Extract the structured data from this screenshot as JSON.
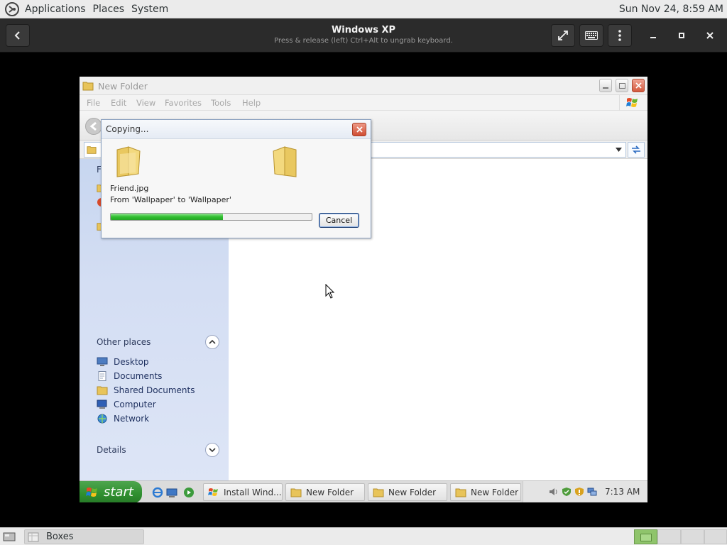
{
  "gnome_panel": {
    "menus": [
      "Applications",
      "Places",
      "System"
    ],
    "clock": "Sun Nov 24,  8:59 AM"
  },
  "boxes_header": {
    "title": "Windows XP",
    "subtitle": "Press & release (left) Ctrl+Alt to ungrab keyboard.",
    "icons": [
      "back-icon",
      "fullscreen-icon",
      "keyboard-icon",
      "menu-icon",
      "minimize-icon",
      "maximize-icon",
      "close-icon"
    ]
  },
  "explorer": {
    "title": "New Folder",
    "menu": [
      "File",
      "Edit",
      "View",
      "Favorites",
      "Tools",
      "Help"
    ],
    "sidebar": {
      "partial_heading": "F",
      "other_places": {
        "heading": "Other places",
        "items": [
          {
            "label": "Desktop",
            "icon": "desktop-icon"
          },
          {
            "label": "Documents",
            "icon": "documents-icon"
          },
          {
            "label": "Shared Documents",
            "icon": "shared-folder-icon"
          },
          {
            "label": "Computer",
            "icon": "computer-icon"
          },
          {
            "label": "Network",
            "icon": "network-icon"
          }
        ]
      },
      "details": {
        "heading": "Details"
      }
    }
  },
  "copy_dialog": {
    "title": "Copying...",
    "file_name": "Friend.jpg",
    "from_to": "From 'Wallpaper' to 'Wallpaper'",
    "progress": 0.56,
    "cancel_label": "Cancel"
  },
  "xp_taskbar": {
    "start_label": "start",
    "tasks": [
      "Install Wind...",
      "New Folder",
      "New Folder",
      "New Folder"
    ],
    "clock": "7:13 AM"
  },
  "gnome_bottom": {
    "task_label": "Boxes",
    "workspaces": 4,
    "active_workspace": 1
  },
  "colors": {
    "progress_green": "#31c031",
    "xp_sidebar": "#d4def3",
    "start_green": "#2f8f2f"
  }
}
